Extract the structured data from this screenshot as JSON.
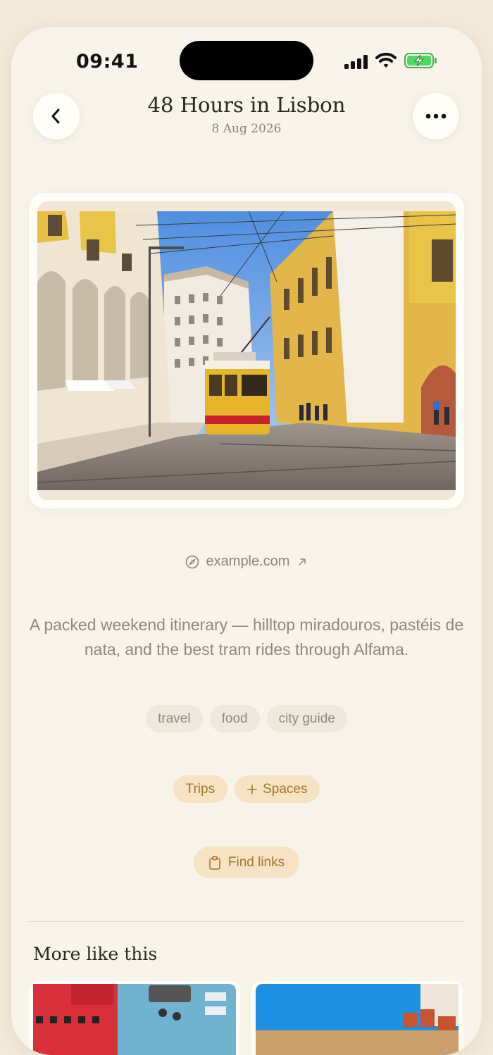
{
  "status": {
    "time": "09:41"
  },
  "header": {
    "title": "48 Hours in Lisbon",
    "date": "8 Aug 2026"
  },
  "link": {
    "domain": "example.com"
  },
  "description": "A packed weekend itinerary — hilltop miradouros, pastéis de nata, and the best tram rides through Alfama.",
  "tags": [
    "travel",
    "food",
    "city guide"
  ],
  "spaces": {
    "chip": "Trips",
    "add_label": "Spaces"
  },
  "actions": {
    "find_links": "Find links"
  },
  "more": {
    "title": "More like this"
  },
  "colors": {
    "background": "#f8f4ea",
    "accent": "#a8742a",
    "accent_bg": "#f7e2c2",
    "tag_bg": "#efe9dd"
  },
  "icons": [
    "back-icon",
    "more-icon",
    "compass-icon",
    "arrow-up-right-icon",
    "plus-icon",
    "clipboard-icon"
  ]
}
